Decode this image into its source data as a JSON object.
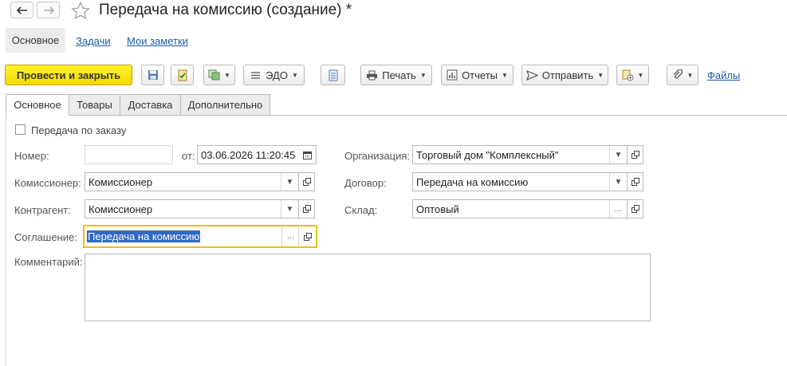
{
  "window": {
    "title": "Передача на комиссию (создание) *"
  },
  "nav_tabs": [
    {
      "label": "Основное"
    },
    {
      "label": "Задачи"
    },
    {
      "label": "Мои заметки"
    }
  ],
  "toolbar": {
    "post_close": "Провести и закрыть",
    "edo": "ЭДО",
    "print": "Печать",
    "reports": "Отчеты",
    "send": "Отправить",
    "files": "Файлы"
  },
  "form_tabs": [
    {
      "label": "Основное"
    },
    {
      "label": "Товары"
    },
    {
      "label": "Доставка"
    },
    {
      "label": "Дополнительно"
    }
  ],
  "form": {
    "by_order_label": "Передача по заказу",
    "number_label": "Номер:",
    "number_value": "",
    "date_label": "от:",
    "date_value": "03.06.2026 11:20:45",
    "organization_label": "Организация:",
    "organization_value": "Торговый дом \"Комплексный\"",
    "commissioner_label": "Комиссионер:",
    "commissioner_value": "Комиссионер",
    "contract_label": "Договор:",
    "contract_value": "Передача на комиссию",
    "counterparty_label": "Контрагент:",
    "counterparty_value": "Комиссионер",
    "warehouse_label": "Склад:",
    "warehouse_value": "Оптовый",
    "agreement_label": "Соглашение:",
    "agreement_value": "Передача на комиссию",
    "comment_label": "Комментарий:",
    "comment_value": ""
  },
  "icons": {
    "back": "arrow-left-icon",
    "forward": "arrow-right-icon",
    "favorite": "star-icon"
  },
  "colors": {
    "primary_button": "#f5d900",
    "focus_border": "#e8c200",
    "link": "#1b5aa8",
    "selection": "#3168c6"
  }
}
